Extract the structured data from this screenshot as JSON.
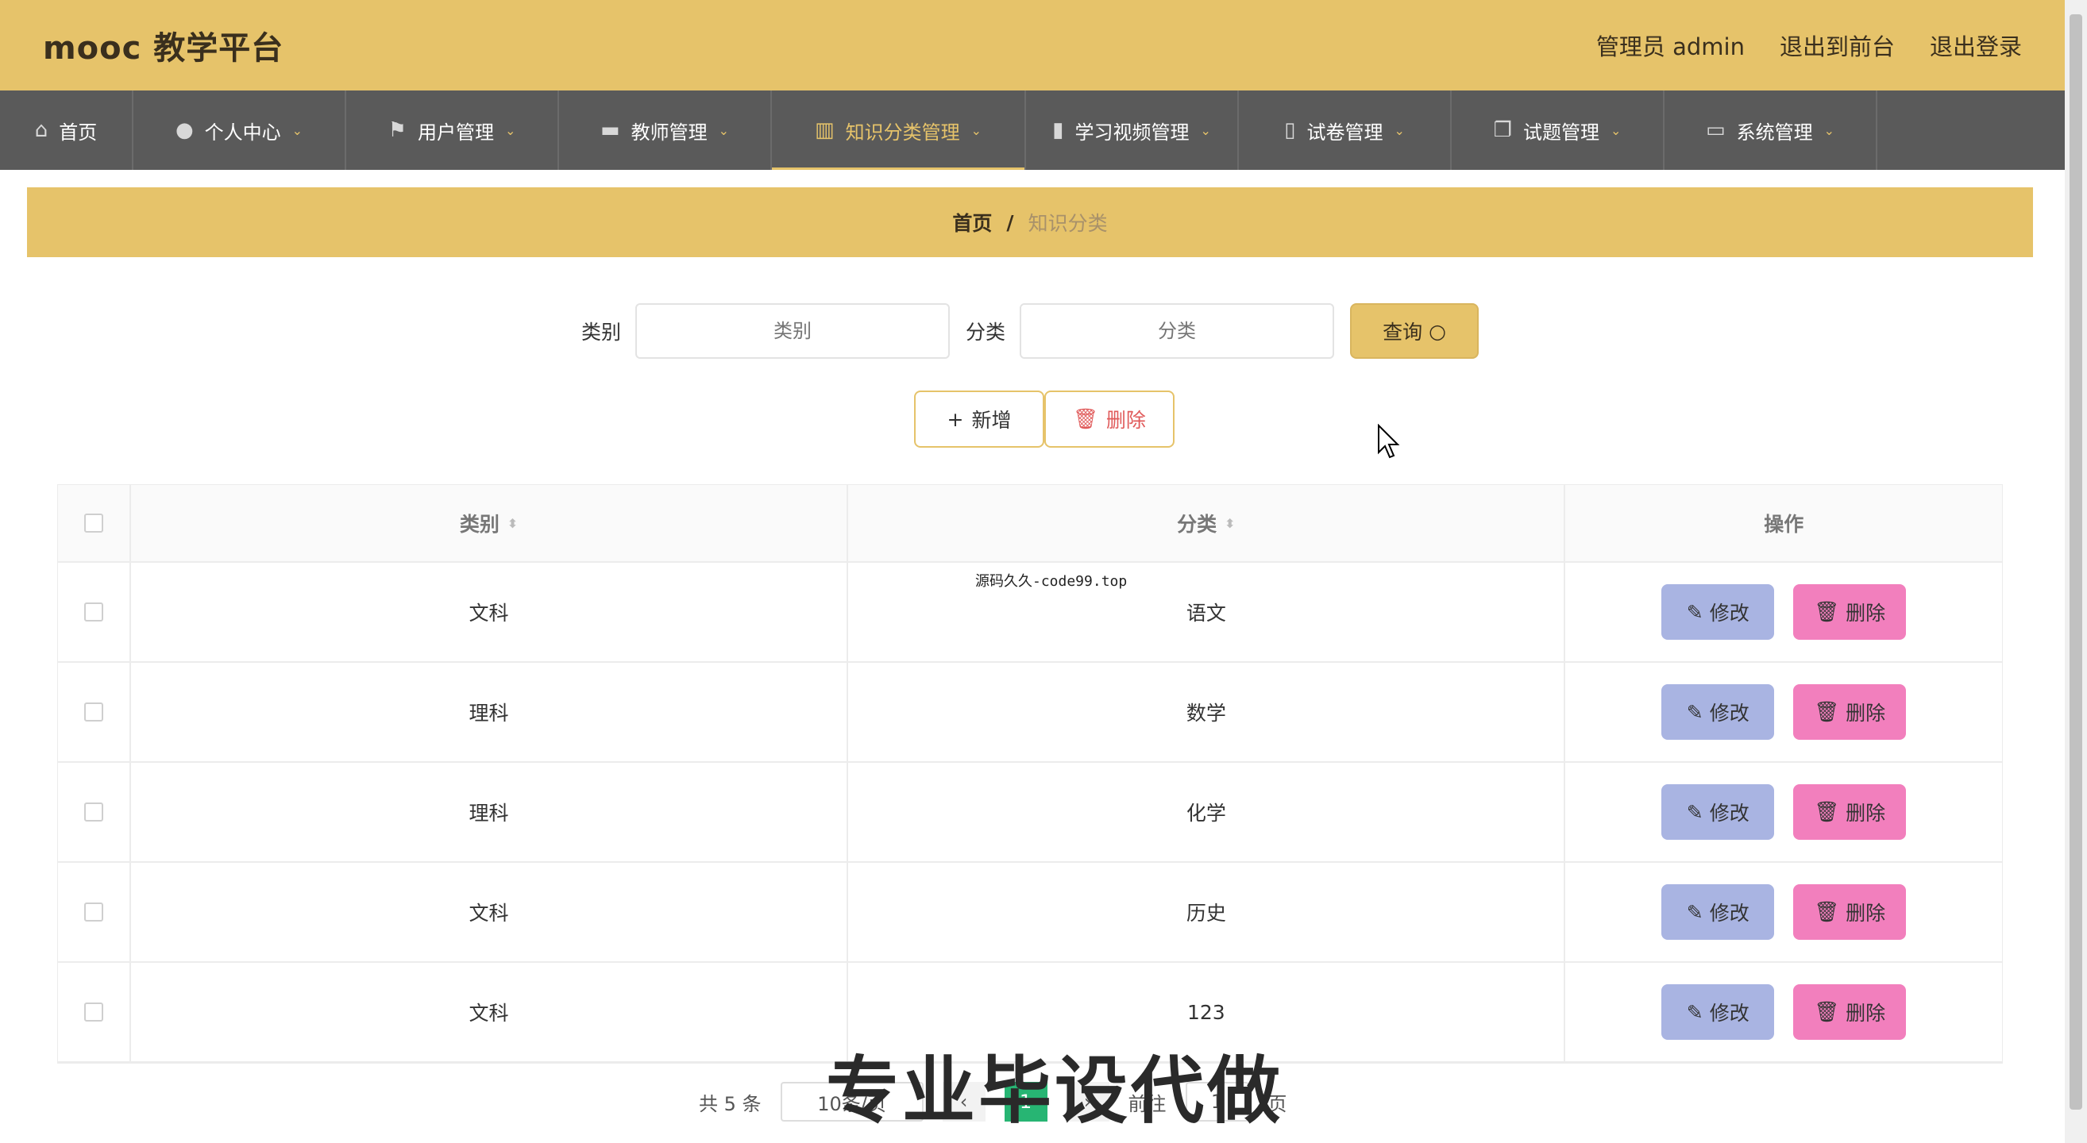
{
  "header": {
    "title": "mooc 教学平台",
    "admin_label": "管理员 admin",
    "to_front": "退出到前台",
    "logout": "退出登录"
  },
  "nav": {
    "items": [
      {
        "label": "首页",
        "icon": "home-icon"
      },
      {
        "label": "个人中心",
        "icon": "user-icon"
      },
      {
        "label": "用户管理",
        "icon": "flag-icon"
      },
      {
        "label": "教师管理",
        "icon": "book-icon"
      },
      {
        "label": "知识分类管理",
        "icon": "library-icon"
      },
      {
        "label": "学习视频管理",
        "icon": "bar-chart-icon"
      },
      {
        "label": "试卷管理",
        "icon": "mobile-icon"
      },
      {
        "label": "试题管理",
        "icon": "copy-icon"
      },
      {
        "label": "系统管理",
        "icon": "settings-icon"
      }
    ],
    "active_index": 4
  },
  "breadcrumb": {
    "home": "首页",
    "separator": "/",
    "current": "知识分类"
  },
  "search": {
    "category_label": "类别",
    "category_placeholder": "类别",
    "type_label": "分类",
    "type_placeholder": "分类",
    "query_button": "查询"
  },
  "actions": {
    "add": "新增",
    "delete": "删除"
  },
  "table": {
    "headers": {
      "category": "类别",
      "type": "分类",
      "ops": "操作"
    },
    "edit_label": "修改",
    "delete_label": "删除",
    "rows": [
      {
        "category": "文科",
        "type": "语文"
      },
      {
        "category": "理科",
        "type": "数学"
      },
      {
        "category": "理科",
        "type": "化学"
      },
      {
        "category": "文科",
        "type": "历史"
      },
      {
        "category": "文科",
        "type": "123"
      }
    ]
  },
  "pagination": {
    "total": "共 5 条",
    "page_size": "10条/页",
    "current_page": "1",
    "goto_prefix": "前往",
    "goto_value": "1",
    "goto_suffix": "页"
  },
  "overlay": {
    "small_tag": "源码久久-code99.top",
    "banner": "专业毕设代做"
  },
  "colors": {
    "accent": "#e6c36a",
    "nav_bg": "#5a5a5a",
    "edit_btn": "#a9b4e2",
    "delete_btn": "#f27fbd",
    "page_current": "#27b573"
  }
}
